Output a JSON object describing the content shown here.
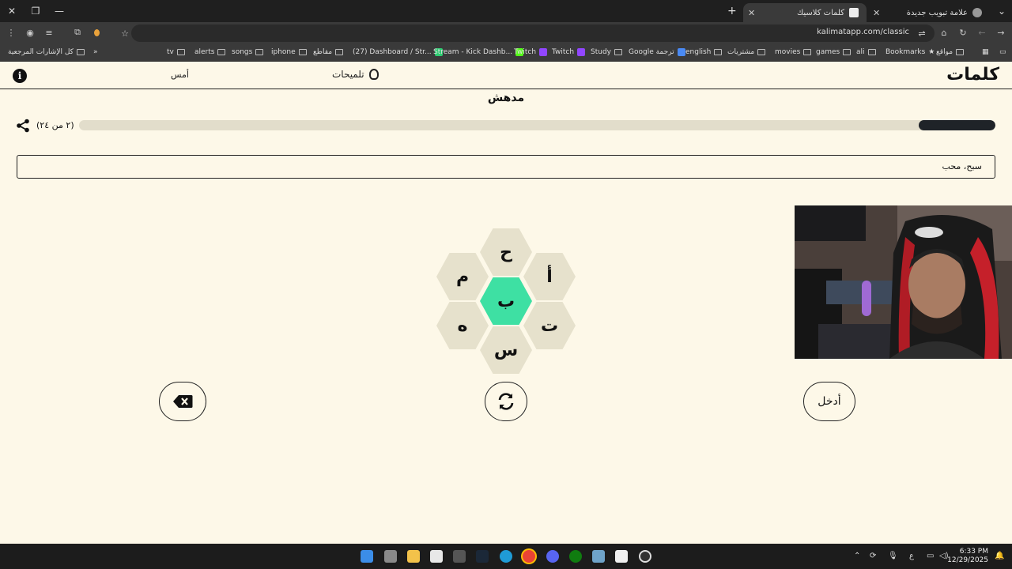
{
  "browser": {
    "tabs": [
      {
        "title": "علامة تبويب جديدة",
        "active": false
      },
      {
        "title": "كلمات كلاسيك",
        "active": true
      }
    ],
    "url": "kalimatapp.com/classic",
    "bookmarks": [
      "Bookmarks",
      "ali",
      "games",
      "movies",
      "مشتريات",
      "english",
      "Google ترجمة",
      "Study",
      "Twitch",
      "Twitch",
      "Stream - Kick Dashb...",
      "(27) Dashboard / Str...",
      "مقاطع",
      "iphone",
      "songs",
      "alerts",
      "tv"
    ],
    "bookmarks_left": "مواقع",
    "all_bookmarks": "كل الإشارات المرجعية"
  },
  "app": {
    "logo": "كلمات",
    "hints_label": "تلميحات",
    "yesterday_label": "أمس",
    "info_icon": "i",
    "rank": "مدهش",
    "progress_count": "(٢ من ٢٤)",
    "progress_fraction": 0.0833,
    "found_words": "سبح، محب",
    "letters": {
      "top": "ح",
      "upper_left": "م",
      "upper_right": "أ",
      "center": "ب",
      "lower_left": "ه",
      "lower_right": "ت",
      "bottom": "س"
    },
    "enter_label": "أدخل"
  },
  "taskbar": {
    "time": "6:33 PM",
    "date": "12/29/2025",
    "lang": "ع"
  },
  "colors": {
    "background": "#fdf8e8",
    "center_hex": "#3ee0a3",
    "outer_hex": "#e6e1cc",
    "progress_fill": "#1f2328"
  }
}
